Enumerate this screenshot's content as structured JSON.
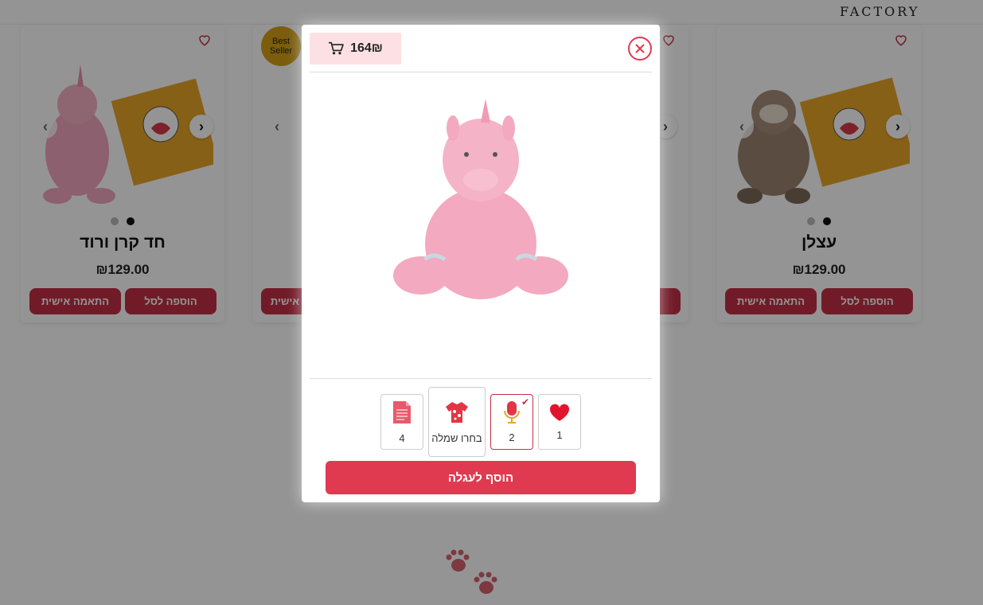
{
  "header": {
    "logo": "FACTORY"
  },
  "products": [
    {
      "name": "חד קרן ורוד",
      "price": "₪129.00",
      "add_label": "הוספה לסל",
      "custom_label": "התאמה אישית"
    },
    {
      "name": "",
      "price": "",
      "add_label": "",
      "custom_label": "אישית",
      "badge": "Best Seller"
    },
    {
      "name": "",
      "price": "",
      "add_label": "",
      "custom_label": ""
    },
    {
      "name": "עצלן",
      "price": "₪129.00",
      "add_label": "הוספה לסל",
      "custom_label": "התאמה אישית"
    }
  ],
  "modal": {
    "total": "164₪",
    "options": [
      {
        "label": "4",
        "icon": "letter-icon"
      },
      {
        "label": "בחרו שמלה",
        "icon": "shirt-icon"
      },
      {
        "label": "2",
        "icon": "microphone-icon",
        "selected": true
      },
      {
        "label": "1",
        "icon": "heart-icon"
      }
    ],
    "add_to_cart": "הוסף לעגלה"
  },
  "colors": {
    "brand_red": "#e03a50",
    "button_red": "#c42f45",
    "badge_pink": "#fde0e4",
    "best_seller_gold": "#d4a017"
  }
}
